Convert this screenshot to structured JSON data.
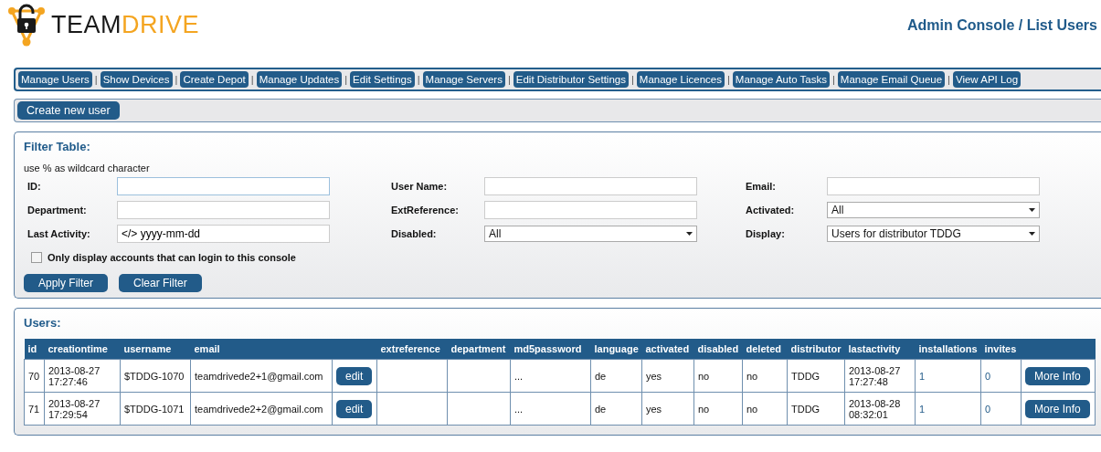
{
  "logo": {
    "words": [
      "TEAM",
      "DRIVE"
    ]
  },
  "page_title": "Admin Console / List Users",
  "nav": {
    "separator": "|",
    "items": [
      "Manage Users",
      "Show Devices",
      "Create Depot",
      "Manage Updates",
      "Edit Settings",
      "Manage Servers",
      "Edit Distributor Settings",
      "Manage Licences",
      "Manage Auto Tasks",
      "Manage Email Queue",
      "View API Log"
    ]
  },
  "actions": [
    "Create new user"
  ],
  "filter": {
    "title": "Filter Table:",
    "hint": "use % as wildcard character",
    "fields": [
      {
        "label": "ID:",
        "kind": "input",
        "focused": true
      },
      {
        "label": "User Name:",
        "kind": "input",
        "focused": false
      },
      {
        "label": "Email:",
        "kind": "input",
        "focused": false
      },
      {
        "label": "Department:",
        "kind": "input",
        "focused": false
      },
      {
        "label": "ExtReference:",
        "kind": "input",
        "focused": false
      },
      {
        "label": "Activated:",
        "kind": "select",
        "value": "All"
      },
      {
        "label": "Last Activity:",
        "kind": "input",
        "value": "</> yyyy-mm-dd",
        "focused": false
      },
      {
        "label": "Disabled:",
        "kind": "select",
        "value": "All"
      },
      {
        "label": "Display:",
        "kind": "select",
        "value": "Users for distributor TDDG"
      }
    ],
    "checkbox": {
      "label": "Only display accounts that can login to this console",
      "checked": false
    },
    "buttons": [
      "Apply Filter",
      "Clear Filter"
    ]
  },
  "users": {
    "title": "Users:",
    "columns": [
      "id",
      "creationtime",
      "username",
      "email",
      "",
      "extreference",
      "department",
      "md5password",
      "language",
      "activated",
      "disabled",
      "deleted",
      "distributor",
      "lastactivity",
      "installations",
      "invites",
      ""
    ],
    "rows": [
      {
        "cells": [
          {
            "kind": "text",
            "text": "70"
          },
          {
            "kind": "text",
            "text": "2013-08-27\n17:27:46"
          },
          {
            "kind": "text",
            "text": "$TDDG-1070"
          },
          {
            "kind": "text",
            "text": "teamdrivede2+1@gmail.com"
          },
          {
            "kind": "button",
            "text": "edit"
          },
          {
            "kind": "empty"
          },
          {
            "kind": "empty"
          },
          {
            "kind": "text",
            "text": "..."
          },
          {
            "kind": "text",
            "text": "de"
          },
          {
            "kind": "text",
            "text": "yes"
          },
          {
            "kind": "text",
            "text": "no"
          },
          {
            "kind": "text",
            "text": "no"
          },
          {
            "kind": "text",
            "text": "TDDG"
          },
          {
            "kind": "text",
            "text": "2013-08-27\n17:27:48"
          },
          {
            "kind": "link",
            "text": "1"
          },
          {
            "kind": "link",
            "text": "0"
          },
          {
            "kind": "button",
            "text": "More Info"
          }
        ]
      },
      {
        "cells": [
          {
            "kind": "text",
            "text": "71"
          },
          {
            "kind": "text",
            "text": "2013-08-27\n17:29:54"
          },
          {
            "kind": "text",
            "text": "$TDDG-1071"
          },
          {
            "kind": "text",
            "text": "teamdrivede2+2@gmail.com"
          },
          {
            "kind": "button",
            "text": "edit"
          },
          {
            "kind": "empty"
          },
          {
            "kind": "empty"
          },
          {
            "kind": "text",
            "text": "..."
          },
          {
            "kind": "text",
            "text": "de"
          },
          {
            "kind": "text",
            "text": "yes"
          },
          {
            "kind": "text",
            "text": "no"
          },
          {
            "kind": "text",
            "text": "no"
          },
          {
            "kind": "text",
            "text": "TDDG"
          },
          {
            "kind": "text",
            "text": "2013-08-28\n08:32:01"
          },
          {
            "kind": "link",
            "text": "1"
          },
          {
            "kind": "link",
            "text": "0"
          },
          {
            "kind": "button",
            "text": "More Info"
          }
        ]
      }
    ]
  }
}
